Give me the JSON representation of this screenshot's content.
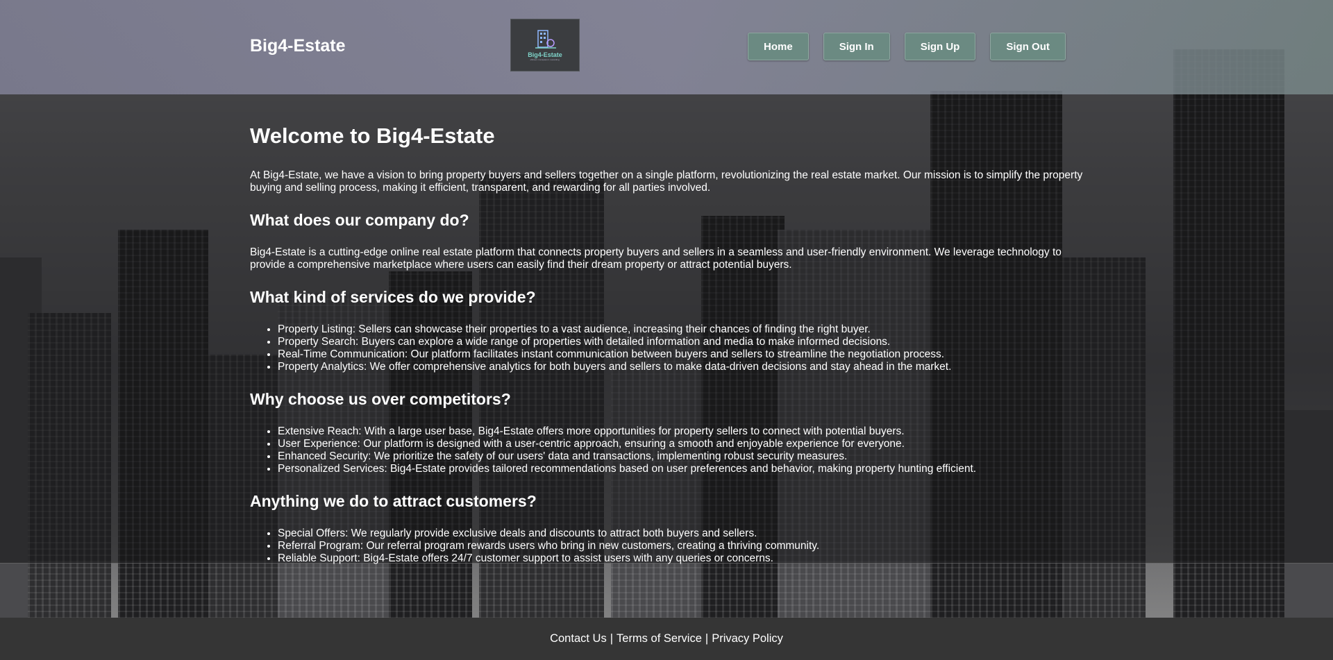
{
  "header": {
    "brand": "Big4-Estate",
    "logo": {
      "text": "Big4-Estate",
      "subtext": "efficient. transparent. rewarding."
    },
    "nav": [
      {
        "label": "Home"
      },
      {
        "label": "Sign In"
      },
      {
        "label": "Sign Up"
      },
      {
        "label": "Sign Out"
      }
    ]
  },
  "main": {
    "title": "Welcome to Big4-Estate",
    "intro": "At Big4-Estate, we have a vision to bring property buyers and sellers together on a single platform, revolutionizing the real estate market. Our mission is to simplify the property buying and selling process, making it efficient, transparent, and rewarding for all parties involved.",
    "sections": [
      {
        "heading": "What does our company do?",
        "paragraph": "Big4-Estate is a cutting-edge online real estate platform that connects property buyers and sellers in a seamless and user-friendly environment. We leverage technology to provide a comprehensive marketplace where users can easily find their dream property or attract potential buyers."
      },
      {
        "heading": "What kind of services do we provide?",
        "items": [
          "Property Listing: Sellers can showcase their properties to a vast audience, increasing their chances of finding the right buyer.",
          "Property Search: Buyers can explore a wide range of properties with detailed information and media to make informed decisions.",
          "Real-Time Communication: Our platform facilitates instant communication between buyers and sellers to streamline the negotiation process.",
          "Property Analytics: We offer comprehensive analytics for both buyers and sellers to make data-driven decisions and stay ahead in the market."
        ]
      },
      {
        "heading": "Why choose us over competitors?",
        "items": [
          "Extensive Reach: With a large user base, Big4-Estate offers more opportunities for property sellers to connect with potential buyers.",
          "User Experience: Our platform is designed with a user-centric approach, ensuring a smooth and enjoyable experience for everyone.",
          "Enhanced Security: We prioritize the safety of our users' data and transactions, implementing robust security measures.",
          "Personalized Services: Big4-Estate provides tailored recommendations based on user preferences and behavior, making property hunting efficient."
        ]
      },
      {
        "heading": "Anything we do to attract customers?",
        "items": [
          "Special Offers: We regularly provide exclusive deals and discounts to attract both buyers and sellers.",
          "Referral Program: Our referral program rewards users who bring in new customers, creating a thriving community.",
          "Reliable Support: Big4-Estate offers 24/7 customer support to assist users with any queries or concerns."
        ]
      }
    ]
  },
  "footer": {
    "links": [
      {
        "label": "Contact Us"
      },
      {
        "label": "Terms of Service"
      },
      {
        "label": "Privacy Policy"
      }
    ],
    "separator": "|"
  },
  "colors": {
    "header_bg": "#7c7c8e",
    "nav_button": "#6b8a82",
    "overlay": "#1a1a1c",
    "footer_bg": "#353535",
    "logo_accent": "#7fd3c9"
  }
}
